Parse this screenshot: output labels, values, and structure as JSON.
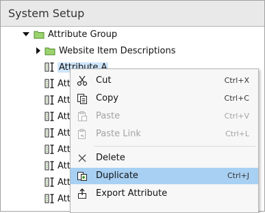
{
  "window": {
    "title": "System Setup"
  },
  "tree": {
    "root": {
      "label": "Attribute Group"
    },
    "child_folder": {
      "label": "Website Item Descriptions"
    },
    "selected_item": {
      "label": "Attribute A"
    },
    "truncated_items": [
      "Attr",
      "Attr",
      "Attr",
      "Attr",
      "Attr",
      "Attr",
      "Attr",
      "Attr"
    ]
  },
  "context_menu": {
    "cut": {
      "label": "Cut",
      "shortcut": "Ctrl+X"
    },
    "copy": {
      "label": "Copy",
      "shortcut": "Ctrl+C"
    },
    "paste": {
      "label": "Paste",
      "shortcut": "Ctrl+V"
    },
    "paste_link": {
      "label": "Paste Link",
      "shortcut": "Ctrl+L"
    },
    "delete": {
      "label": "Delete"
    },
    "duplicate": {
      "label": "Duplicate",
      "shortcut": "Ctrl+J"
    },
    "export_attribute": {
      "label": "Export Attribute"
    }
  },
  "colors": {
    "highlight": "#a8d0f3",
    "selection": "#cfe6fb",
    "folder": "#9bd36e",
    "disabled_text": "#a3a3a3"
  }
}
